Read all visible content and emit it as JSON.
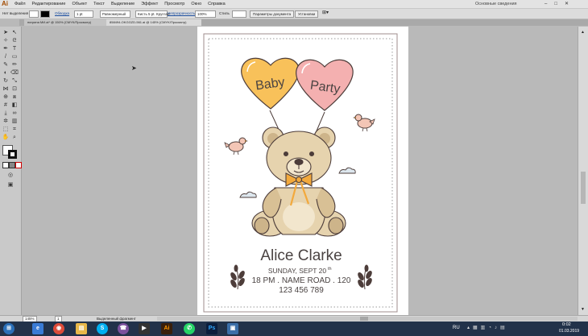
{
  "app": {
    "logo_text": "Ai"
  },
  "menu": [
    "Файл",
    "Редактирование",
    "Объект",
    "Текст",
    "Выделение",
    "Эффект",
    "Просмотр",
    "Окно",
    "Справка"
  ],
  "workspace": {
    "label": "Основные сведения"
  },
  "controlbar": {
    "no_selection": "Нет выделения",
    "stroke_label": "Обводка",
    "stroke_width": "1 pt",
    "profile": "Равномерный",
    "brush": "Кисть 5 pt. Круглая",
    "opacity_label": "Непрозрачность",
    "opacity_value": "100%",
    "style_label": "Стиль",
    "doc_settings": "Параметры документа",
    "preferences": "Установки"
  },
  "tabs": [
    {
      "label": "нигрина МИ.ai* @ 150% (CMYK/Просмотр)"
    },
    {
      "label": "858494-OKGGZD-561.ai @ 145% (CMYK/Просмотр)"
    }
  ],
  "invitation": {
    "balloon_left": "Baby",
    "balloon_right": "Party",
    "name": "Alice Clarke",
    "date_main": "SUNDAY, SEPT 20",
    "date_suffix": "th",
    "time_main": "18 PM . NAME ROAD . 120",
    "phone": "123 456 789"
  },
  "status": {
    "zoom": "145%",
    "page": "1",
    "mode": "Выделенный фрагмент"
  },
  "taskbar": {
    "lang": "RU",
    "time": "0:02",
    "date": "01.03.2019"
  },
  "colors": {
    "balloon_left": "#f8c15a",
    "balloon_right": "#f4b0b0",
    "bear": "#e6d3ae",
    "bear_dark": "#cdb48a",
    "bow": "#f3a93c",
    "text_dark": "#4a4342",
    "line": "#4d3d3a"
  }
}
